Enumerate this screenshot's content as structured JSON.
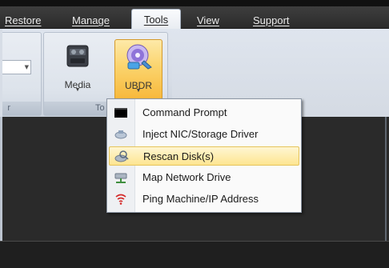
{
  "menubar": {
    "tabs": [
      {
        "label": "Restore"
      },
      {
        "label": "Manage"
      },
      {
        "label": "Tools",
        "active": true
      },
      {
        "label": "View"
      },
      {
        "label": "Support"
      }
    ]
  },
  "ribbon": {
    "groups": [
      {
        "caption": "r"
      },
      {
        "caption": "To"
      }
    ],
    "buttons": [
      {
        "label": "Media",
        "icon": "media-drive-icon"
      },
      {
        "label": "UBDR",
        "icon": "ubdr-disc-icon",
        "state": "pressed"
      }
    ]
  },
  "tools_menu": {
    "items": [
      {
        "label": "Command Prompt",
        "icon": "command-prompt-icon"
      },
      {
        "label": "Inject NIC/Storage Driver",
        "icon": "driver-icon"
      },
      {
        "label": "Rescan Disk(s)",
        "icon": "rescan-disk-icon",
        "highlighted": true
      },
      {
        "label": "Map Network Drive",
        "icon": "network-drive-icon"
      },
      {
        "label": "Ping Machine/IP Address",
        "icon": "ping-icon"
      }
    ]
  },
  "colors": {
    "highlight": "#fde590",
    "pressed_button": "#f7b83b",
    "ribbon": "#dfe5ee"
  }
}
